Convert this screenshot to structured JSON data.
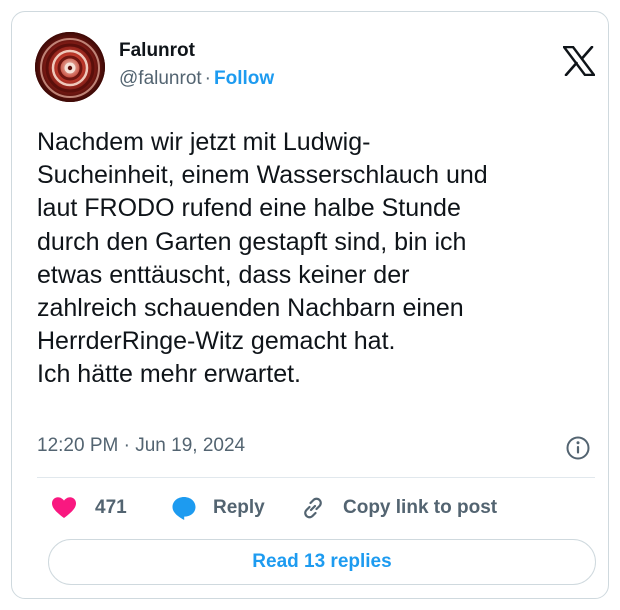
{
  "author": {
    "display_name": "Falunrot",
    "handle": "@falunrot",
    "separator": "·",
    "follow_label": "Follow"
  },
  "tweet": {
    "text": "Nachdem wir jetzt mit Ludwig-\nSucheinheit, einem Wasserschlauch und\nlaut FRODO rufend eine halbe Stunde\ndurch den Garten gestapft sind, bin ich\netwas enttäuscht, dass keiner der\nzahlreich schauenden Nachbarn einen\nHerrderRinge-Witz gemacht hat.\nIch hätte mehr erwartet.",
    "timestamp": "12:20 PM · Jun 19, 2024"
  },
  "actions": {
    "like_count": "471",
    "reply_label": "Reply",
    "copy_label": "Copy link to post"
  },
  "footer": {
    "read_replies_label": "Read 13 replies"
  },
  "icons": {
    "logo": "x-logo-icon",
    "info": "info-icon",
    "like": "heart-icon",
    "reply": "speech-bubble-icon",
    "copy": "link-icon"
  },
  "colors": {
    "accent": "#1d9bf0",
    "like": "#f91880",
    "muted": "#536471",
    "text": "#0f1419"
  }
}
